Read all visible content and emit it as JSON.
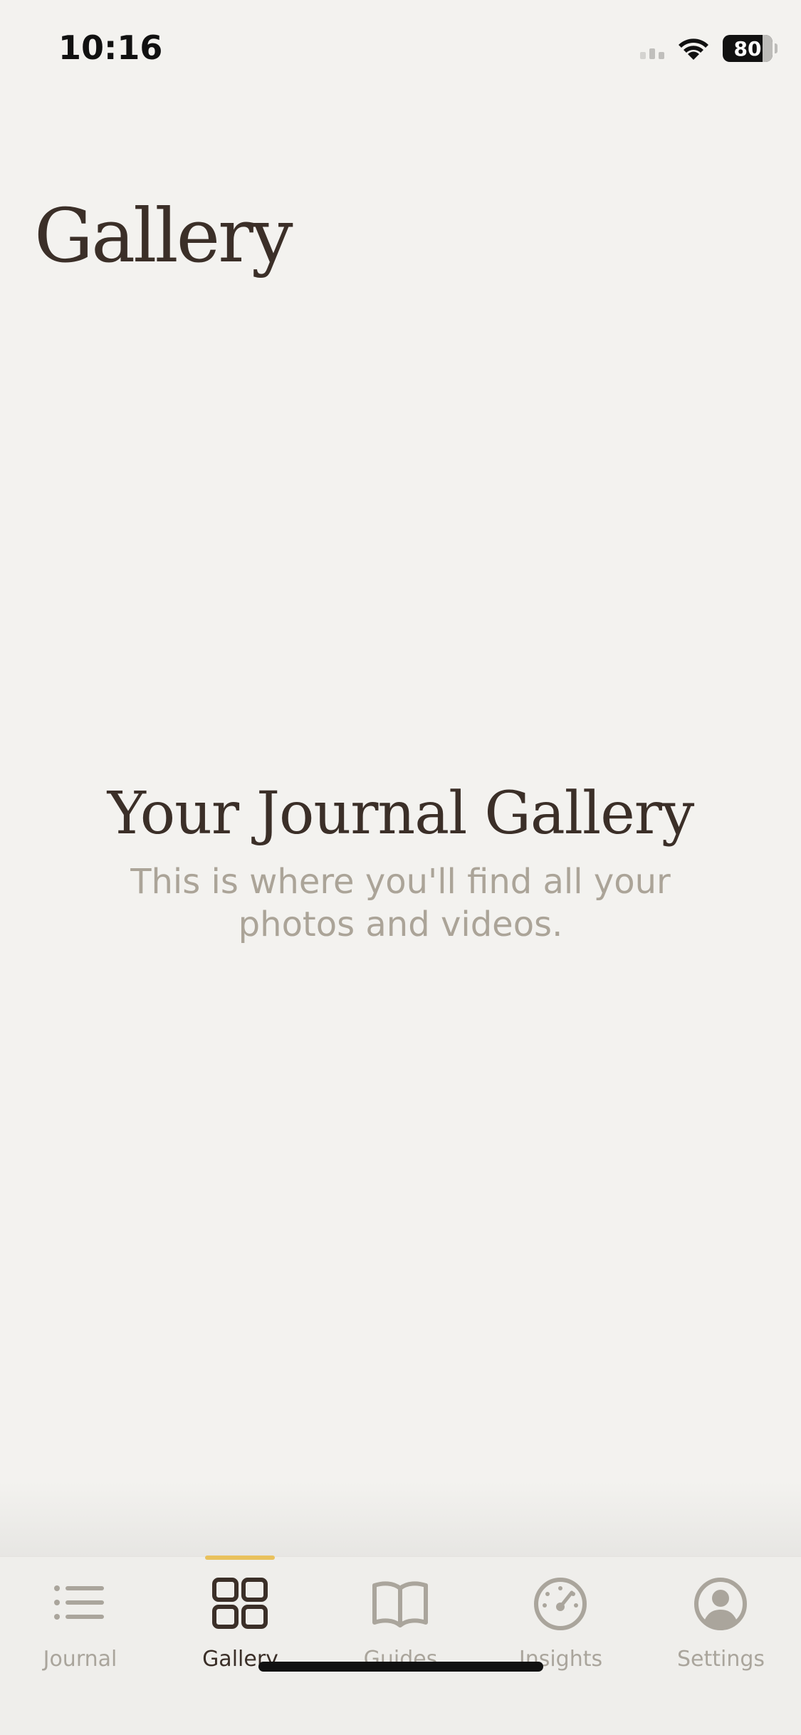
{
  "status_bar": {
    "time": "10:16",
    "battery": "80"
  },
  "header": {
    "title": "Gallery"
  },
  "empty_state": {
    "heading": "Your Journal Gallery",
    "text": "This is where you'll find all your photos and videos."
  },
  "tabs": [
    {
      "label": "Journal",
      "icon": "list-icon",
      "active": false
    },
    {
      "label": "Gallery",
      "icon": "grid-icon",
      "active": true
    },
    {
      "label": "Guides",
      "icon": "book-icon",
      "active": false
    },
    {
      "label": "Insights",
      "icon": "gauge-icon",
      "active": false
    },
    {
      "label": "Settings",
      "icon": "person-circle-icon",
      "active": false
    }
  ],
  "colors": {
    "background": "#f3f2ef",
    "text_dark": "#3b2f28",
    "text_muted": "#aba498",
    "tab_inactive": "#aaa59c",
    "accent": "#e9c15d"
  }
}
